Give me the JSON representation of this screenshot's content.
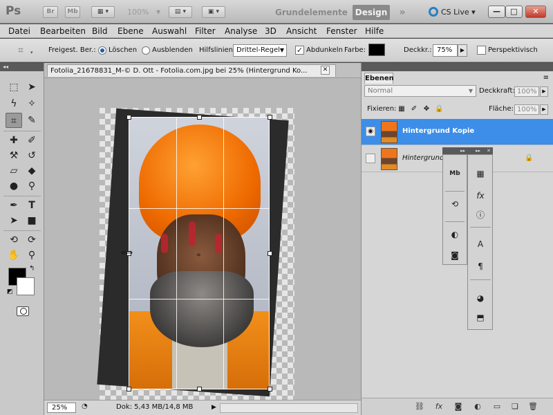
{
  "app": {
    "logo": "Ps",
    "bridge_btn": "Br",
    "minibridge_btn": "Mb",
    "zoom_display": "100%",
    "workspaces": [
      "Grundelemente",
      "Design"
    ],
    "active_workspace": "Design",
    "more_workspaces": "»",
    "cslive": "CS Live",
    "window_controls": [
      "—",
      "□",
      "✕"
    ]
  },
  "menu": [
    "Datei",
    "Bearbeiten",
    "Bild",
    "Ebene",
    "Auswahl",
    "Filter",
    "Analyse",
    "3D",
    "Ansicht",
    "Fenster",
    "Hilfe"
  ],
  "options": {
    "preset_label": "Freigest. Ber.:",
    "delete_label": "Löschen",
    "hide_label": "Ausblenden",
    "guides_label": "Hilfslinien:",
    "guides_value": "Drittel-Regel",
    "darken_label": "Abdunkeln",
    "darken_checked": true,
    "color_label": "Farbe:",
    "color_value": "#000000",
    "opacity_label": "Deckkr.:",
    "opacity_value": "75%",
    "perspective_label": "Perspektivisch",
    "perspective_checked": false
  },
  "document": {
    "tab_title": "Fotolia_21678831_M-© D. Ott - Fotolia.com.jpg bei 25% (Hintergrund Ko...",
    "zoom": "25%",
    "doc_info": "Dok: 5,43 MB/14,8 MB"
  },
  "layers_panel": {
    "tab": "Ebenen",
    "blend_mode": "Normal",
    "opacity_label": "Deckkraft:",
    "opacity_value": "100%",
    "lock_label": "Fixieren:",
    "fill_label": "Fläche:",
    "fill_value": "100%",
    "layers": [
      {
        "name": "Hintergrund Kopie",
        "visible": true,
        "selected": true
      },
      {
        "name": "Hintergrund",
        "visible": false,
        "selected": false,
        "locked": true
      }
    ]
  },
  "colors": {
    "selection": "#3c8ee8",
    "foreground": "#000000",
    "background": "#ffffff"
  }
}
